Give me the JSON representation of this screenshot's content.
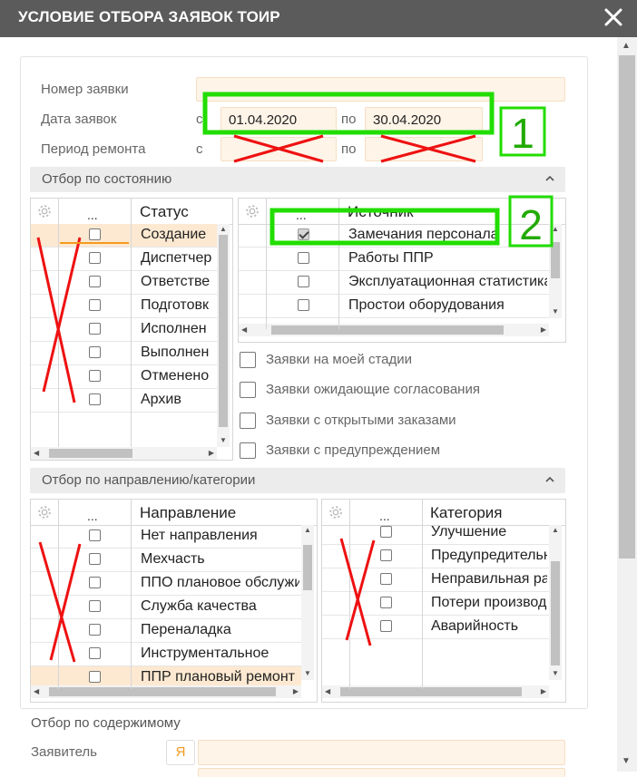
{
  "dialog": {
    "title": "УСЛОВИЕ ОТБОРА ЗАЯВОК ТОИР"
  },
  "filters": {
    "request_number_label": "Номер заявки",
    "request_number_value": "",
    "request_date_label": "Дата заявок",
    "repair_period_label": "Период ремонта",
    "from_label": "с",
    "to_label": "по",
    "request_date_from": "01.04.2020",
    "request_date_to": "30.04.2020",
    "repair_from": "",
    "repair_to": ""
  },
  "state_section": {
    "title": "Отбор по состоянию",
    "status_grid": {
      "col_dots": "...",
      "col_title": "Статус",
      "rows": [
        {
          "label": "Создание",
          "checked": false,
          "selected": true
        },
        {
          "label": "Диспетчер",
          "checked": false,
          "selected": false
        },
        {
          "label": "Ответстве",
          "checked": false,
          "selected": false
        },
        {
          "label": "Подготовк",
          "checked": false,
          "selected": false
        },
        {
          "label": "Исполнен",
          "checked": false,
          "selected": false
        },
        {
          "label": "Выполнен",
          "checked": false,
          "selected": false
        },
        {
          "label": "Отменено",
          "checked": false,
          "selected": false
        },
        {
          "label": "Архив",
          "checked": false,
          "selected": false
        }
      ]
    },
    "source_grid": {
      "col_dots": "...",
      "col_title": "Источник",
      "rows": [
        {
          "label": "Замечания персонала",
          "checked": true,
          "selected": false
        },
        {
          "label": "Работы ППР",
          "checked": false,
          "selected": false
        },
        {
          "label": "Эксплуатационная статистика",
          "checked": false,
          "selected": false
        },
        {
          "label": "Простои оборудования",
          "checked": false,
          "selected": false
        }
      ]
    },
    "options": [
      {
        "label": "Заявки на моей стадии",
        "checked": false
      },
      {
        "label": "Заявки ожидающие согласования",
        "checked": false
      },
      {
        "label": "Заявки с открытыми заказами",
        "checked": false
      },
      {
        "label": "Заявки с предупреждением",
        "checked": false
      }
    ]
  },
  "direction_section": {
    "title": "Отбор по направлению/категории",
    "direction_grid": {
      "col_dots": "...",
      "col_title": "Направление",
      "rows": [
        {
          "label": "Нет направления",
          "checked": false,
          "selected": false
        },
        {
          "label": "Мехчасть",
          "checked": false,
          "selected": false
        },
        {
          "label": "ППО плановое обслуживание",
          "checked": false,
          "selected": false
        },
        {
          "label": "Служба качества",
          "checked": false,
          "selected": false
        },
        {
          "label": "Переналадка",
          "checked": false,
          "selected": false
        },
        {
          "label": "Инструментальное",
          "checked": false,
          "selected": false
        },
        {
          "label": "ППР плановый ремонт",
          "checked": false,
          "selected": true
        }
      ]
    },
    "category_grid": {
      "col_dots": "...",
      "col_title": "Категория",
      "rows": [
        {
          "label": "Улучшение",
          "checked": false,
          "selected": false
        },
        {
          "label": "Предупредительный",
          "checked": false,
          "selected": false
        },
        {
          "label": "Неправильная работа",
          "checked": false,
          "selected": false
        },
        {
          "label": "Потери производства",
          "checked": false,
          "selected": false
        },
        {
          "label": "Аварийность",
          "checked": false,
          "selected": false
        }
      ]
    }
  },
  "content_section": {
    "title": "Отбор по содержимому",
    "applicant_label": "Заявитель",
    "me_button": "Я",
    "applicant_value": ""
  },
  "annotations": {
    "mark_1": "1",
    "mark_2": "2"
  },
  "colors": {
    "field_bg": "#fef4e8",
    "selected_row": "#fde9d1",
    "annotation_green": "#22dd00",
    "annotation_red": "#ee1111",
    "accent_orange": "#f39a1f"
  }
}
